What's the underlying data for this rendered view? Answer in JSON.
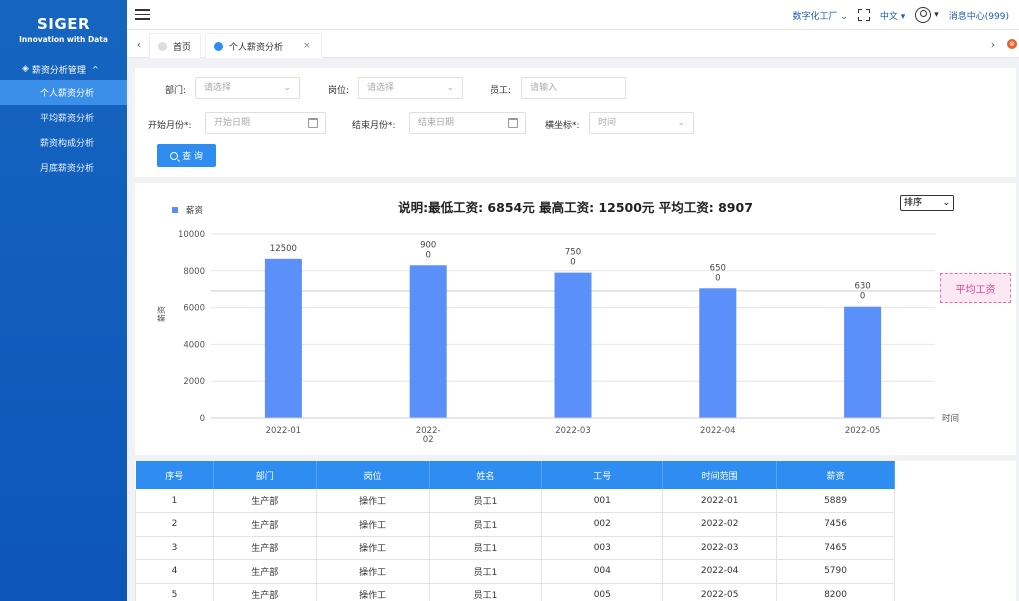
{
  "sidebar": {
    "brand": "SIGER",
    "tagline": "Innovation with Data",
    "group_label": "薪资分析管理",
    "items": [
      {
        "label": "个人薪资分析"
      },
      {
        "label": "平均薪资分析"
      },
      {
        "label": "薪资构成分析"
      },
      {
        "label": "月底薪资分析"
      }
    ]
  },
  "header": {
    "factory": "数字化工厂",
    "language": "中文",
    "messages": "消息中心(999)"
  },
  "tabs": [
    {
      "label": "首页"
    },
    {
      "label": "个人薪资分析",
      "close": "×"
    }
  ],
  "filters": {
    "dept_label": "部门:",
    "dept_placeholder": "请选择",
    "post_label": "岗位:",
    "post_placeholder": "请选择",
    "emp_label": "员工:",
    "emp_placeholder": "请输入",
    "start_label": "开始月份*:",
    "start_placeholder": "开始日期",
    "end_label": "结束月份*:",
    "end_placeholder": "结束日期",
    "xaxis_label": "横坐标*:",
    "xaxis_placeholder": "时间",
    "query_label": "查 询"
  },
  "chart_panel": {
    "title": "说明:最低工资: 6854元   最高工资: 12500元   平均工资: 8907",
    "sort_label": "排序",
    "avg_tag": "平均工资"
  },
  "chart_data": {
    "type": "bar",
    "categories": [
      "2022-01",
      "2022-02",
      "2022-03",
      "2022-04",
      "2022-05"
    ],
    "category_display": [
      [
        "2022-01"
      ],
      [
        "2022-",
        "02"
      ],
      [
        "2022-03"
      ],
      [
        "2022-04"
      ],
      [
        "2022-05"
      ]
    ],
    "values": [
      8650,
      8300,
      7900,
      7050,
      6050
    ],
    "data_labels": [
      [
        "12500"
      ],
      [
        "900",
        "0"
      ],
      [
        "750",
        "0"
      ],
      [
        "650",
        "0"
      ],
      [
        "630",
        "0"
      ]
    ],
    "series": [
      {
        "name": "薪资",
        "color": "#5b8ff9"
      }
    ],
    "xlabel": "时间",
    "ylabel": "薪资",
    "ylim": [
      0,
      10000
    ],
    "yticks": [
      0,
      2000,
      4000,
      6000,
      8000,
      10000
    ],
    "average_line": 6907,
    "grid": true,
    "legend": "top-left"
  },
  "table": {
    "columns": [
      "序号",
      "部门",
      "岗位",
      "姓名",
      "工号",
      "时间范围",
      "薪资"
    ],
    "rows": [
      [
        "1",
        "生产部",
        "操作工",
        "员工1",
        "001",
        "2022-01",
        "5889"
      ],
      [
        "2",
        "生产部",
        "操作工",
        "员工1",
        "002",
        "2022-02",
        "7456"
      ],
      [
        "3",
        "生产部",
        "操作工",
        "员工1",
        "003",
        "2022-03",
        "7465"
      ],
      [
        "4",
        "生产部",
        "操作工",
        "员工1",
        "004",
        "2022-04",
        "5790"
      ],
      [
        "5",
        "生产部",
        "操作工",
        "员工1",
        "005",
        "2022-05",
        "8200"
      ]
    ]
  }
}
